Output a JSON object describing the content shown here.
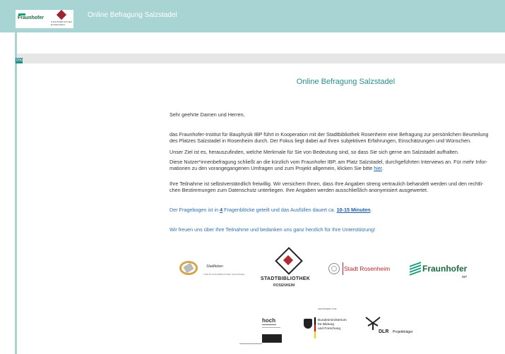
{
  "header": {
    "app_title": "Online Befragung Salzstadel",
    "logo_fraunhofer": "Fraunhofer",
    "logo_fraunhofer_sub": "IBP",
    "logo_stadtbibliothek": "STADTBIBLIOTHEK ROSENHEIM"
  },
  "progress": {
    "value_percent": 0,
    "label": "0%"
  },
  "main": {
    "heading": "Online Befragung Salzstadel",
    "greeting": "Sehr geehrte Damen und Herren,",
    "paragraph1_line1": "das Fraunhofer-Institut für Bauphysik IBP führt in Kooperation mit der Stadtbibliothek Rosenheim eine Befragung zur persönlichen Beurteilung",
    "paragraph1_line2": "des Platzes Salzstadel in Rosenheim durch. Der Fokus liegt dabei auf Ihren subjektiven Erfahrungen, Einschätzungen und Wünschen.",
    "paragraph2": "Unser Ziel ist es, herauszufinden, welche Merkmale für Sie von Bedeutung sind, so dass Sie sich gerne am Salzstadel aufhalten.",
    "paragraph3_line1": "Diese Nutzer*innenbefragung schließt an die kürzlich vom Fraunhofer IBP, am Platz Salzstadel, durchgeführten Interviews an. Für mehr Infor-",
    "paragraph3_line2": "mationen zu den vorangegangenen Umfragen und zum Projekt allgemein, klicken Sie bitte",
    "paragraph3_link": "hier",
    "paragraph4_line1": "Ihre Teilnahme ist selbstverständlich freiwillig. Wir versichern Ihnen, dass Ihre Angaben streng vertraulich behandelt werden und den rechtli-",
    "paragraph4_line2": "chen Bestimmungen zum Datenschutz unterliegen. Ihre Angaben werden ausschließlich anonymisiert ausgewertet.",
    "paragraph5_pre": "Der Fragebogen ist in",
    "paragraph5_num": "4",
    "paragraph5_mid": "Fragenblöcke geteilt und das Ausfüllen dauert ca.",
    "paragraph5_time": "10-15 Minuten",
    "paragraph6": "Wir freuen uns über Ihre Teilnahme und bedanken uns ganz herzlich für Ihre Unterstützung!"
  },
  "partners": {
    "stadtleben": "Stadtleben",
    "stadtleben_sub": "FORUM STADTBIBLIOTHEK SALZSTADEL",
    "stadtbibliothek_line1": "STADTBIBLIOTHEK",
    "stadtbibliothek_line2": "ROSENHEIM",
    "stadt_rosenheim": "Stadt Rosenheim",
    "fraunhofer": "Fraunhofer",
    "fraunhofer_sub": "IBP",
    "hoch": "hoch",
    "bmbf_top": "GEFÖRDERT VOM",
    "bmbf_line1": "Bundesministerium",
    "bmbf_line2": "für Bildung",
    "bmbf_line3": "und Forschung",
    "dlr": "DLR",
    "dlr_sub": "Projektträger"
  }
}
